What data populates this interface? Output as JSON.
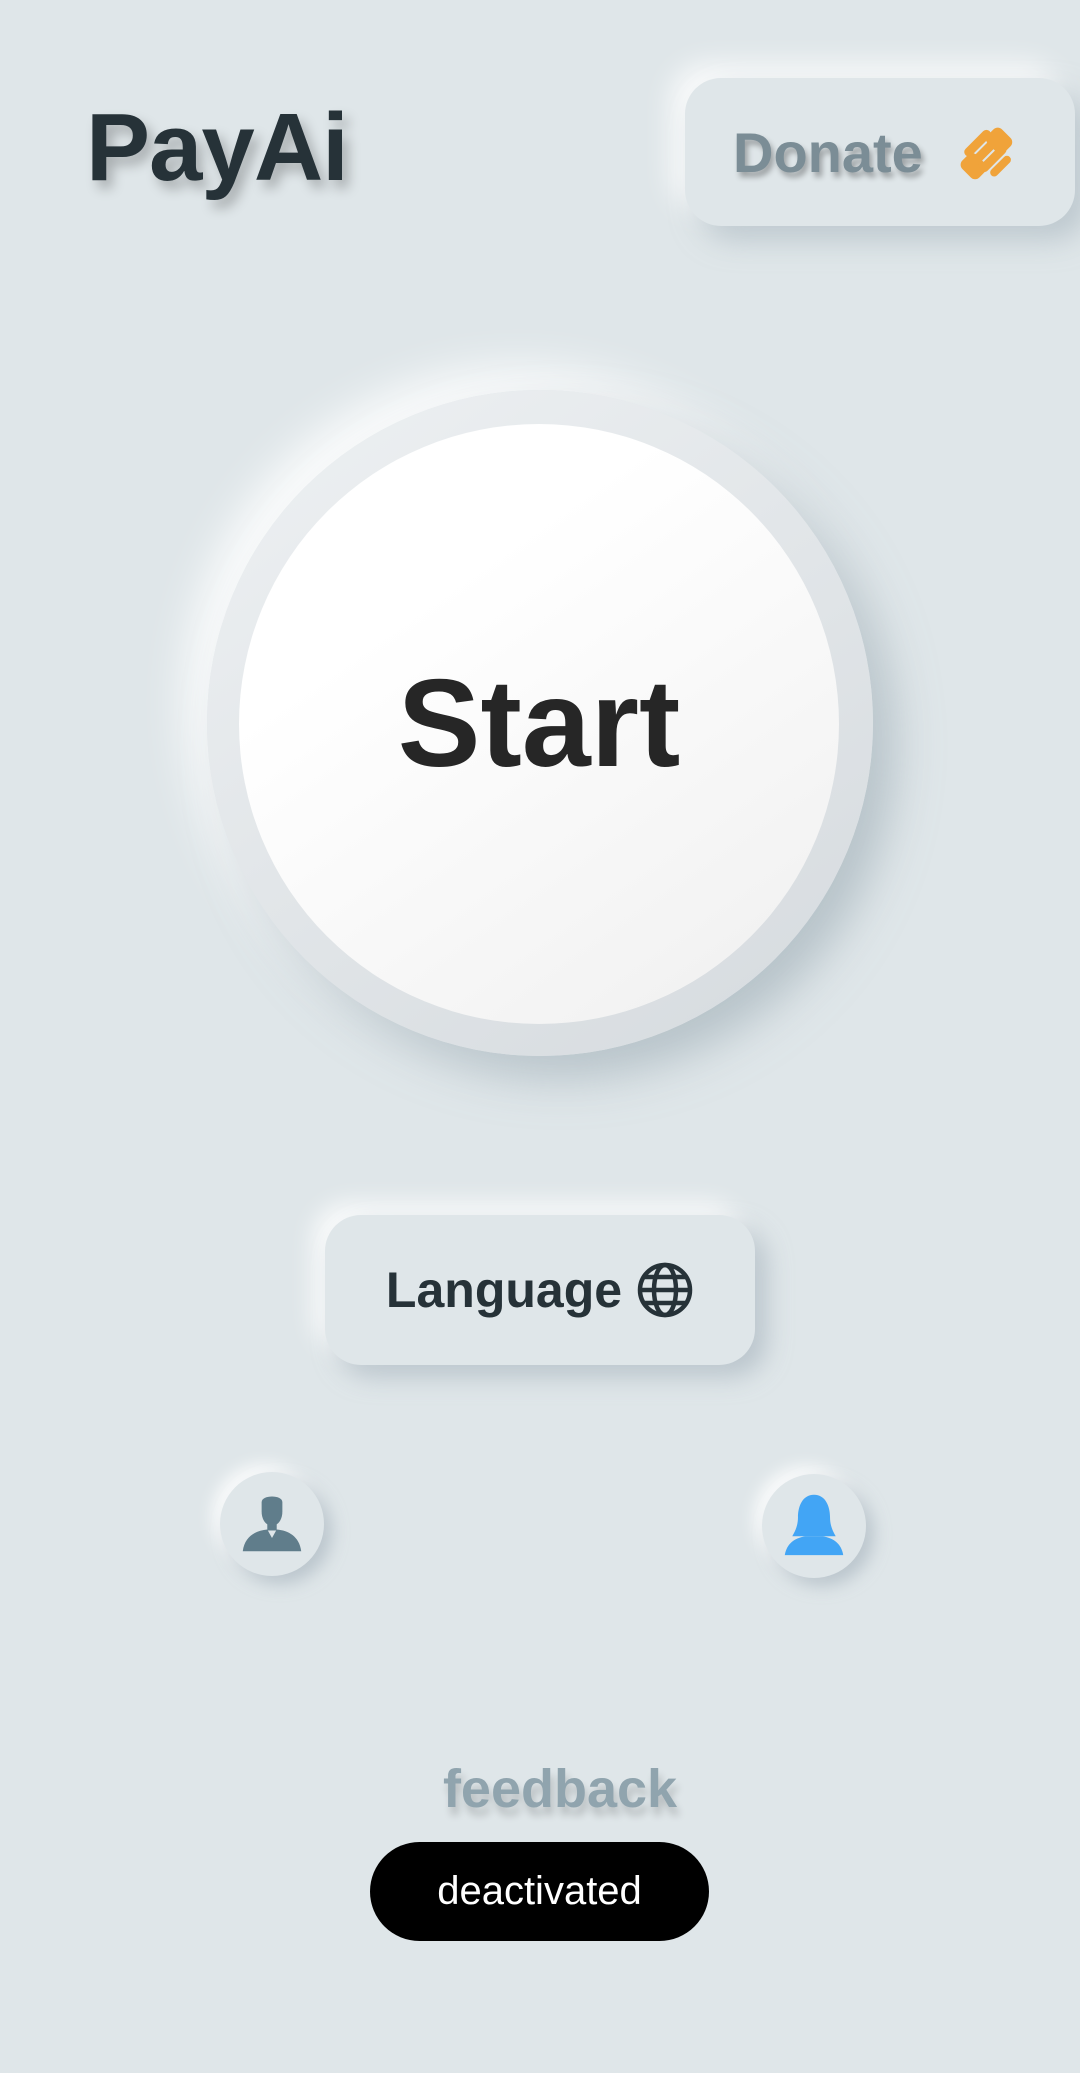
{
  "header": {
    "app_title": "PayAi",
    "donate_label": "Donate",
    "donate_icon": "handshake-icon"
  },
  "main": {
    "start_label": "Start",
    "language_label": "Language",
    "language_icon": "globe-icon"
  },
  "avatars": [
    {
      "icon": "male-user-icon",
      "color": "#607d8b"
    },
    {
      "icon": "female-user-icon",
      "color": "#42a5f5"
    }
  ],
  "footer": {
    "feedback_label": "feedback",
    "status_label": "deactivated"
  },
  "colors": {
    "background": "#dfe6e9",
    "title": "#263238",
    "donate_text": "#7b8d96",
    "donate_icon": "#f0a33a",
    "feedback_text": "#90a4ae",
    "status_bg": "#000000"
  }
}
